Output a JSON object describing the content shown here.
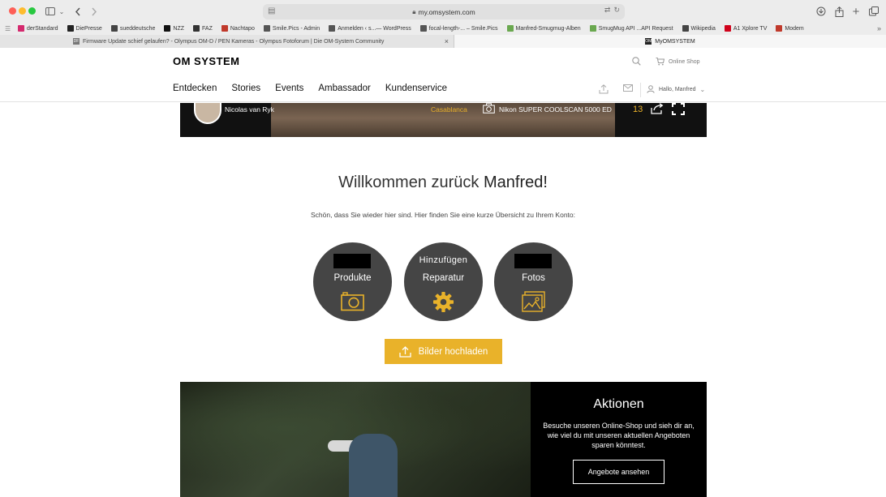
{
  "browser": {
    "url": "my.omsystem.com",
    "bookmarks": [
      {
        "label": "derStandard",
        "icon": "derstandard-icon",
        "color": "#d42a6e"
      },
      {
        "label": "DiePresse",
        "icon": "diepresse-icon",
        "color": "#222222"
      },
      {
        "label": "sueddeutsche",
        "icon": "sueddeutsche-icon",
        "color": "#444444"
      },
      {
        "label": "NZZ",
        "icon": "nzz-icon",
        "color": "#111111"
      },
      {
        "label": "FAZ",
        "icon": "faz-icon",
        "color": "#333333"
      },
      {
        "label": "Nachtapo",
        "icon": "nachtapo-icon",
        "color": "#c0392b"
      },
      {
        "label": "Smile.Pics - Admin",
        "icon": "smilepics-icon",
        "color": "#555555"
      },
      {
        "label": "Anmelden ‹ s...— WordPress",
        "icon": "wordpress-icon",
        "color": "#555555"
      },
      {
        "label": "focal-length-... – Smile.Pics",
        "icon": "smilepics-icon",
        "color": "#555555"
      },
      {
        "label": "Manfred-Smugmug-Alben",
        "icon": "smugmug-icon",
        "color": "#6aa84f"
      },
      {
        "label": "SmugMug API ...API Request",
        "icon": "smugmug-icon",
        "color": "#6aa84f"
      },
      {
        "label": "Wikipedia",
        "icon": "wikipedia-icon",
        "color": "#444444"
      },
      {
        "label": "A1 Xplore TV",
        "icon": "a1-icon",
        "color": "#d0021b"
      },
      {
        "label": "Modem",
        "icon": "modem-icon",
        "color": "#c0392b"
      }
    ],
    "tabs": [
      {
        "label": "Firmware Update schief gelaufen? - Olympus OM-D / PEN Kameras - Olympus Fotoforum | Die OM-System Community",
        "fav": "DF",
        "close": "×"
      },
      {
        "label": "MyOMSYSTEM",
        "fav": "OM"
      }
    ]
  },
  "header": {
    "logo": "OM SYSTEM",
    "shop": "Online Shop",
    "nav": [
      "Entdecken",
      "Stories",
      "Events",
      "Ambassador",
      "Kundenservice"
    ],
    "user": "Hallo, Manfred"
  },
  "photo_strip": {
    "author": "Nicolas van Ryk",
    "location": "Casablanca",
    "camera": "Nikon SUPER COOLSCAN 5000 ED",
    "count": "13"
  },
  "welcome": {
    "title_prefix": "Willkommen zurück ",
    "title_name": "Manfred!",
    "subtitle": "Schön, dass Sie wieder hier sind. Hier finden Sie eine kurze Übersicht zu Ihrem Konto:"
  },
  "circles": [
    {
      "top": "",
      "label": "Produkte",
      "icon": "camera-icon",
      "redacted": true
    },
    {
      "top": "Hinzufügen",
      "label": "Reparatur",
      "icon": "gear-icon",
      "redacted": false
    },
    {
      "top": "",
      "label": "Fotos",
      "icon": "photos-icon",
      "redacted": true
    }
  ],
  "upload": {
    "label": "Bilder hochladen"
  },
  "promo": {
    "title": "Aktionen",
    "text": "Besuche unseren Online-Shop und sieh dir an, wie viel du mit unseren aktuellen Angeboten sparen könntest.",
    "button": "Angebote ansehen"
  },
  "colors": {
    "accent": "#e9b22a",
    "circle": "#454545",
    "dark": "#000000"
  }
}
